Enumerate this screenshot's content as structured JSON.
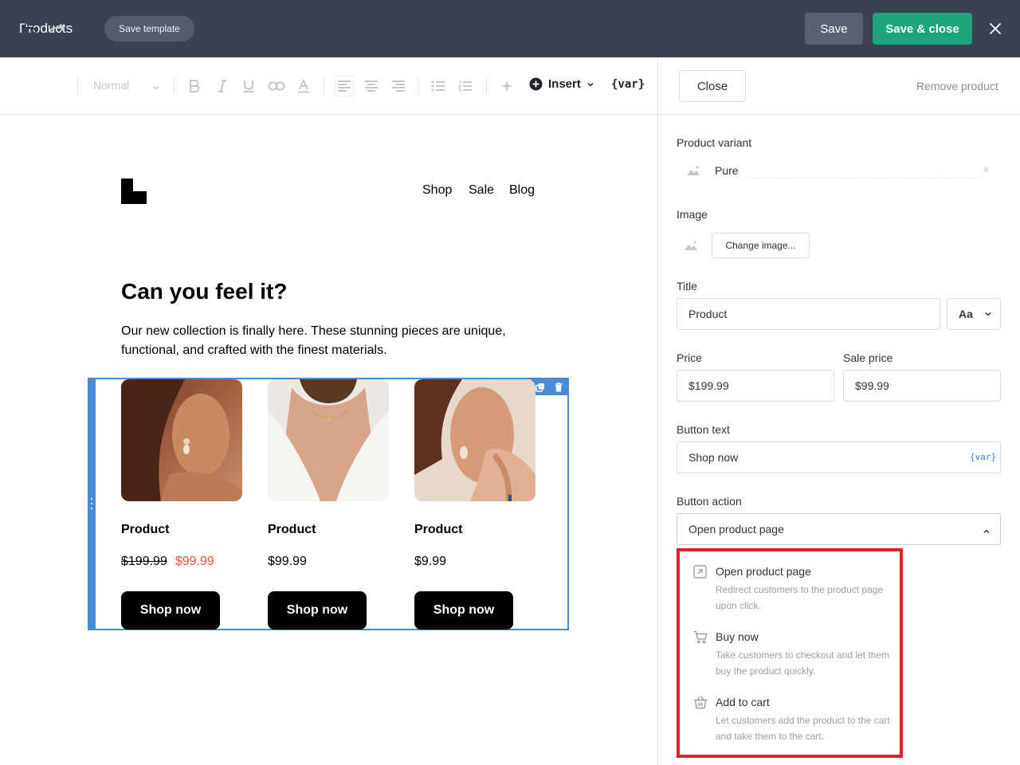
{
  "header": {
    "title": "Products",
    "save_template": "Save template",
    "save": "Save",
    "save_close": "Save & close"
  },
  "toolbar": {
    "text_style": "Normal",
    "insert": "Insert",
    "var": "{var}"
  },
  "email": {
    "nav": [
      "Shop",
      "Sale",
      "Blog"
    ],
    "heading": "Can you feel it?",
    "body": "Our new collection is finally here. These stunning pieces are unique, functional, and crafted with the finest materials.",
    "products": [
      {
        "title": "Product",
        "old_price": "$199.99",
        "price": "$99.99",
        "button": "Shop now"
      },
      {
        "title": "Product",
        "price": "$99.99",
        "button": "Shop now"
      },
      {
        "title": "Product",
        "price": "$9.99",
        "button": "Shop now"
      }
    ]
  },
  "panel": {
    "close": "Close",
    "remove": "Remove product",
    "variant_label": "Product variant",
    "variant_value": "Pure",
    "image_label": "Image",
    "change_image": "Change image...",
    "title_label": "Title",
    "title_value": "Product",
    "font_select": "Aa",
    "price_label": "Price",
    "price_value": "$199.99",
    "sale_label": "Sale price",
    "sale_value": "$99.99",
    "button_text_label": "Button text",
    "button_text_value": "Shop now",
    "var_tag": "{var}",
    "button_action_label": "Button action",
    "button_action_value": "Open product page"
  },
  "dropdown": {
    "options": [
      {
        "title": "Open product page",
        "desc": "Redirect customers to the product page upon click.",
        "icon": "external-link-icon"
      },
      {
        "title": "Buy now",
        "desc": "Take customers to checkout and let them buy the product quickly.",
        "icon": "cart-icon"
      },
      {
        "title": "Add to cart",
        "desc": "Let customers add the product to the cart and take them to the cart.",
        "icon": "basket-icon"
      }
    ]
  },
  "colors": {
    "header_bg": "#3b4150",
    "primary": "#1aa57a",
    "selection": "#4a8bd8",
    "sale": "#e8543d",
    "highlight": "#e0202a"
  }
}
